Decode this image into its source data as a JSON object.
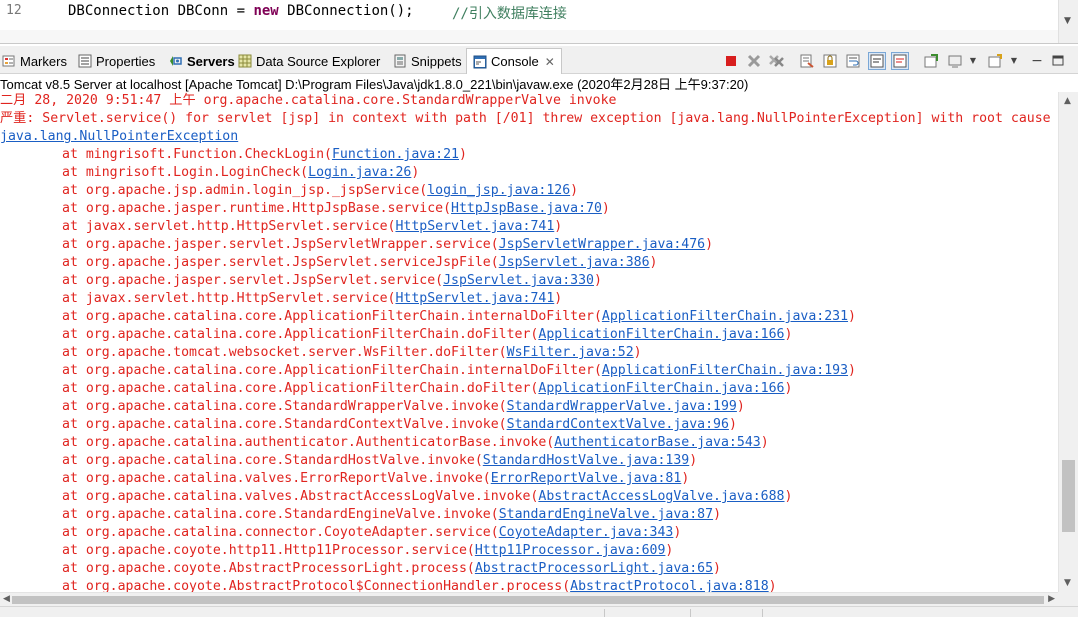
{
  "editor": {
    "line_number": "12",
    "code_type": "DBConnection DBConn = ",
    "code_keyword": "new",
    "code_rest": " DBConnection();",
    "comment": "//引入数据库连接"
  },
  "tabs": [
    {
      "label": "Markers",
      "icon": "markers-icon"
    },
    {
      "label": "Properties",
      "icon": "properties-icon"
    },
    {
      "label": "Servers",
      "icon": "servers-icon"
    },
    {
      "label": "Data Source Explorer",
      "icon": "data-source-explorer-icon"
    },
    {
      "label": "Snippets",
      "icon": "snippets-icon"
    },
    {
      "label": "Console",
      "icon": "console-icon",
      "active": true
    }
  ],
  "console": {
    "title": "Tomcat v8.5 Server at localhost [Apache Tomcat] D:\\Program Files\\Java\\jdk1.8.0_221\\bin\\javaw.exe (2020年2月28日 上午9:37:20)",
    "header_lines": [
      "二月 28, 2020 9:51:47 上午 org.apache.catalina.core.StandardWrapperValve invoke",
      "严重: Servlet.service() for servlet [jsp] in context with path [/01] threw exception [java.lang.NullPointerException] with root cause"
    ],
    "exception_link": "java.lang.NullPointerException",
    "stack": [
      {
        "text": "at mingrisoft.Function.CheckLogin(",
        "link": "Function.java:21"
      },
      {
        "text": "at mingrisoft.Login.LoginCheck(",
        "link": "Login.java:26"
      },
      {
        "text": "at org.apache.jsp.admin.login_jsp._jspService(",
        "link": "login_jsp.java:126"
      },
      {
        "text": "at org.apache.jasper.runtime.HttpJspBase.service(",
        "link": "HttpJspBase.java:70"
      },
      {
        "text": "at javax.servlet.http.HttpServlet.service(",
        "link": "HttpServlet.java:741"
      },
      {
        "text": "at org.apache.jasper.servlet.JspServletWrapper.service(",
        "link": "JspServletWrapper.java:476"
      },
      {
        "text": "at org.apache.jasper.servlet.JspServlet.serviceJspFile(",
        "link": "JspServlet.java:386"
      },
      {
        "text": "at org.apache.jasper.servlet.JspServlet.service(",
        "link": "JspServlet.java:330"
      },
      {
        "text": "at javax.servlet.http.HttpServlet.service(",
        "link": "HttpServlet.java:741"
      },
      {
        "text": "at org.apache.catalina.core.ApplicationFilterChain.internalDoFilter(",
        "link": "ApplicationFilterChain.java:231"
      },
      {
        "text": "at org.apache.catalina.core.ApplicationFilterChain.doFilter(",
        "link": "ApplicationFilterChain.java:166"
      },
      {
        "text": "at org.apache.tomcat.websocket.server.WsFilter.doFilter(",
        "link": "WsFilter.java:52"
      },
      {
        "text": "at org.apache.catalina.core.ApplicationFilterChain.internalDoFilter(",
        "link": "ApplicationFilterChain.java:193"
      },
      {
        "text": "at org.apache.catalina.core.ApplicationFilterChain.doFilter(",
        "link": "ApplicationFilterChain.java:166"
      },
      {
        "text": "at org.apache.catalina.core.StandardWrapperValve.invoke(",
        "link": "StandardWrapperValve.java:199"
      },
      {
        "text": "at org.apache.catalina.core.StandardContextValve.invoke(",
        "link": "StandardContextValve.java:96"
      },
      {
        "text": "at org.apache.catalina.authenticator.AuthenticatorBase.invoke(",
        "link": "AuthenticatorBase.java:543"
      },
      {
        "text": "at org.apache.catalina.core.StandardHostValve.invoke(",
        "link": "StandardHostValve.java:139"
      },
      {
        "text": "at org.apache.catalina.valves.ErrorReportValve.invoke(",
        "link": "ErrorReportValve.java:81"
      },
      {
        "text": "at org.apache.catalina.valves.AbstractAccessLogValve.invoke(",
        "link": "AbstractAccessLogValve.java:688"
      },
      {
        "text": "at org.apache.catalina.core.StandardEngineValve.invoke(",
        "link": "StandardEngineValve.java:87"
      },
      {
        "text": "at org.apache.catalina.connector.CoyoteAdapter.service(",
        "link": "CoyoteAdapter.java:343"
      },
      {
        "text": "at org.apache.coyote.http11.Http11Processor.service(",
        "link": "Http11Processor.java:609"
      },
      {
        "text": "at org.apache.coyote.AbstractProcessorLight.process(",
        "link": "AbstractProcessorLight.java:65"
      },
      {
        "text": "at org.apache.coyote.AbstractProtocol$ConnectionHandler.process(",
        "link": "AbstractProtocol.java:818"
      }
    ]
  },
  "colors": {
    "error_text": "#e0241f",
    "link_text": "#1a5ec4"
  }
}
